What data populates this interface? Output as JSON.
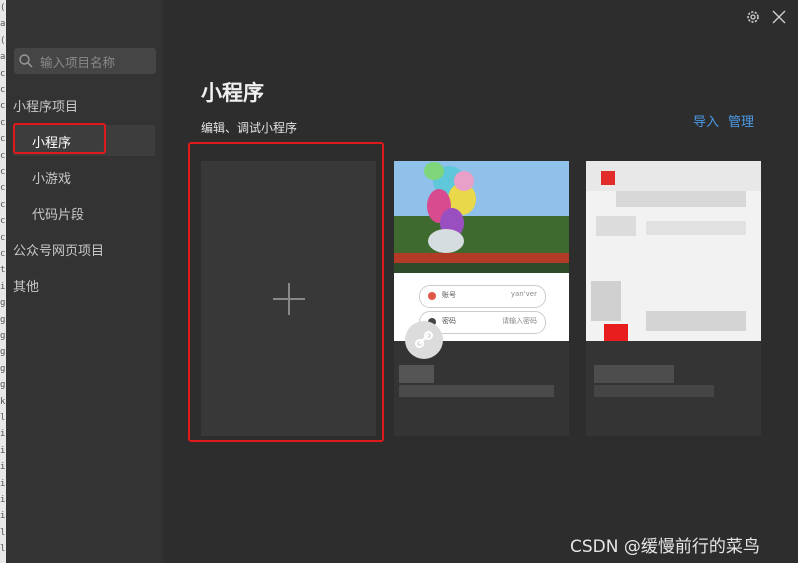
{
  "app": {
    "window_controls": {
      "settings_icon": "gear-icon",
      "close_icon": "close-icon"
    }
  },
  "left_strip_chars": [
    "(",
    "a",
    "(",
    "a",
    "c",
    "c",
    "c",
    "c",
    "c",
    "c",
    "c",
    "c",
    "c",
    "c",
    "c",
    "c",
    "t",
    "i",
    "g",
    "g",
    "g",
    "g",
    "g",
    "g",
    "k",
    "l",
    "i",
    "i",
    "i",
    "i",
    "i",
    "i",
    "l",
    "l"
  ],
  "sidebar": {
    "search_placeholder": "输入项目名称",
    "sections": [
      {
        "label": "小程序项目",
        "items": [
          {
            "label": "小程序",
            "active": true
          },
          {
            "label": "小游戏"
          },
          {
            "label": "代码片段"
          }
        ]
      },
      {
        "label": "公众号网页项目"
      },
      {
        "label": "其他"
      }
    ]
  },
  "main": {
    "title": "小程序",
    "subtitle": "编辑、调试小程序",
    "actions": {
      "import": "导入",
      "manage": "管理"
    }
  },
  "project_cards": [
    {
      "fields": [
        {
          "label": "账号",
          "value": "yan'ver"
        },
        {
          "label": "密码",
          "value": "请输入密码"
        }
      ]
    },
    {}
  ],
  "colors": {
    "accent": "#4a9ae8",
    "highlight": "#e0191b",
    "background": "#2d2d2d",
    "sidebar": "#333334"
  },
  "watermark": "CSDN @缓慢前行的菜鸟"
}
